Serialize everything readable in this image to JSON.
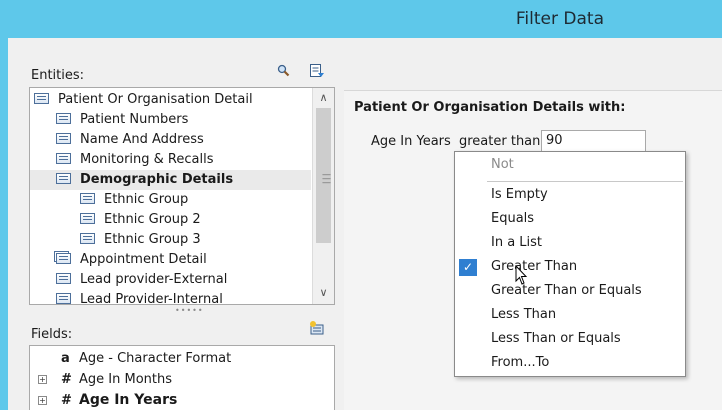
{
  "window": {
    "title": "Filter Data"
  },
  "entities": {
    "label": "Entities:",
    "items": [
      {
        "label": "Patient Or Organisation Detail",
        "level": 0,
        "selected": false
      },
      {
        "label": "Patient Numbers",
        "level": 1,
        "selected": false
      },
      {
        "label": "Name And Address",
        "level": 1,
        "selected": false
      },
      {
        "label": "Monitoring & Recalls",
        "level": 1,
        "selected": false
      },
      {
        "label": "Demographic Details",
        "level": 1,
        "selected": true
      },
      {
        "label": "Ethnic Group",
        "level": 2,
        "selected": false
      },
      {
        "label": "Ethnic Group 2",
        "level": 2,
        "selected": false
      },
      {
        "label": "Ethnic Group 3",
        "level": 2,
        "selected": false
      },
      {
        "label": "Appointment Detail",
        "level": 1,
        "selected": false
      },
      {
        "label": "Lead provider-External",
        "level": 1,
        "selected": false
      },
      {
        "label": "Lead Provider-Internal",
        "level": 1,
        "selected": false
      }
    ]
  },
  "fields": {
    "label": "Fields:",
    "items": [
      {
        "type_glyph": "a",
        "label": "Age - Character Format",
        "expandable": false
      },
      {
        "type_glyph": "#",
        "label": "Age In Months",
        "expandable": true
      },
      {
        "type_glyph": "#",
        "label": "Age In Years",
        "expandable": true
      }
    ]
  },
  "criteria": {
    "header": "Patient Or Organisation Details with:",
    "field_label": "Age In Years",
    "operator": "greater than",
    "value": "90"
  },
  "operator_menu": {
    "items": [
      {
        "label": "Not",
        "disabled": true,
        "checked": false
      },
      {
        "label": "Is Empty",
        "disabled": false,
        "checked": false
      },
      {
        "label": "Equals",
        "disabled": false,
        "checked": false
      },
      {
        "label": "In a List",
        "disabled": false,
        "checked": false
      },
      {
        "label": "Greater Than",
        "disabled": false,
        "checked": true
      },
      {
        "label": "Greater Than or Equals",
        "disabled": false,
        "checked": false
      },
      {
        "label": "Less Than",
        "disabled": false,
        "checked": false
      },
      {
        "label": "Less Than or Equals",
        "disabled": false,
        "checked": false
      },
      {
        "label": "From...To",
        "disabled": false,
        "checked": false
      }
    ]
  },
  "colors": {
    "titlebar": "#5ec8ea",
    "selection": "#eaeaea",
    "check_accent": "#2f7fd1"
  },
  "icons": {
    "search": "magnifier-icon",
    "export": "export-list-icon",
    "add_field": "add-field-icon",
    "tree_node": "table-icon",
    "check": "checkmark-icon",
    "cursor": "mouse-pointer-icon"
  }
}
